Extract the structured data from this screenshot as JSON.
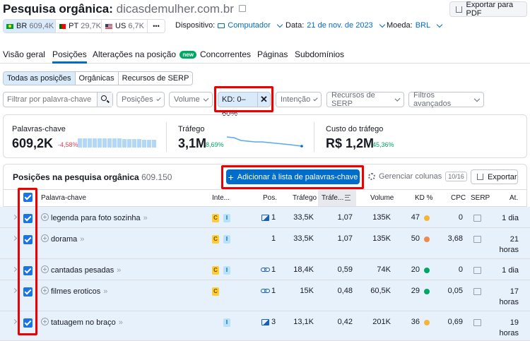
{
  "header": {
    "title": "Pesquisa orgânica:",
    "domain": "dicasdemulher.com.br",
    "export_pdf": "Exportar para PDF"
  },
  "db": [
    {
      "code": "BR",
      "value": "609,4K"
    },
    {
      "code": "PT",
      "value": "29,7K"
    },
    {
      "code": "US",
      "value": "6,7K"
    },
    {
      "more": "•••"
    }
  ],
  "settings": {
    "device_label": "Dispositivo:",
    "device_value": "Computador",
    "date_label": "Data:",
    "date_value": "21 de nov. de 2023",
    "currency_label": "Moeda:",
    "currency_value": "BRL"
  },
  "tabs": [
    {
      "label": "Visão geral"
    },
    {
      "label": "Posições"
    },
    {
      "label": "Alterações na posição",
      "badge": "new"
    },
    {
      "label": "Concorrentes"
    },
    {
      "label": "Páginas"
    },
    {
      "label": "Subdomínios"
    }
  ],
  "subtabs": [
    "Todas as posições",
    "Orgânicas",
    "Recursos de SERP"
  ],
  "filters": {
    "search_placeholder": "Filtrar por palavra-chave",
    "positions": "Posições",
    "volume": "Volume",
    "kd": "KD: 0–60%",
    "intent": "Intenção",
    "serp": "Recursos de SERP",
    "advanced": "Filtros avançados"
  },
  "metrics": [
    {
      "label": "Palavras-chave",
      "value": "609,2K",
      "change": "-4,58%",
      "change_color": "#e8405b"
    },
    {
      "label": "Tráfego",
      "value": "3,1M",
      "change": "8,69%",
      "change_color": "#00a663"
    },
    {
      "label": "Custo do tráfego",
      "value": "R$ 1,2M",
      "change": "45,36%",
      "change_color": "#00a663"
    }
  ],
  "table": {
    "title": "Posições na pesquisa orgânica",
    "count": "609.150",
    "add_button": "Adicionar à lista de palavras-chave",
    "manage_columns": "Gerenciar colunas",
    "columns_count": "10/16",
    "export": "Exportar",
    "headers": [
      "Palavra-chave",
      "Inte...",
      "Pos.",
      "Tráfego",
      "Tráfe...",
      "Volume",
      "KD %",
      "CPC",
      "SERP",
      "At."
    ],
    "rows": [
      {
        "keyword": "legenda para foto sozinha",
        "intent": [
          "C",
          "I"
        ],
        "pos": "1",
        "pos_icon": "image-icon",
        "traffic": "33,5K",
        "traffic_pct": "1,07",
        "volume": "135K",
        "kd": "47",
        "kd_color": "#f5b43b",
        "cpc": "0",
        "updated": "1 dia"
      },
      {
        "keyword": "dorama",
        "intent": [
          "C",
          "I"
        ],
        "pos": "1",
        "pos_icon": "",
        "traffic": "33,5K",
        "traffic_pct": "1,07",
        "volume": "135K",
        "kd": "50",
        "kd_color": "#f08a4b",
        "cpc": "3,68",
        "updated": "21 horas"
      },
      {
        "keyword": "cantadas pesadas",
        "intent": [
          "C",
          "I"
        ],
        "pos": "1",
        "pos_icon": "link-icon",
        "traffic": "18,4K",
        "traffic_pct": "0,59",
        "volume": "74K",
        "kd": "20",
        "kd_color": "#00a663",
        "cpc": "0",
        "updated": "1 dia"
      },
      {
        "keyword": "filmes eroticos",
        "intent": [
          "C"
        ],
        "pos": "1",
        "pos_icon": "link-icon",
        "traffic": "15K",
        "traffic_pct": "0,48",
        "volume": "60,5K",
        "kd": "29",
        "kd_color": "#00a663",
        "cpc": "0,05",
        "updated": "17 horas"
      },
      {
        "keyword": "tatuagem no braço",
        "intent": [
          "I"
        ],
        "pos": "3",
        "pos_icon": "image-icon",
        "traffic": "13,1K",
        "traffic_pct": "0,42",
        "volume": "201K",
        "kd": "36",
        "kd_color": "#f5b43b",
        "cpc": "0,69",
        "updated": "19 horas"
      }
    ]
  }
}
